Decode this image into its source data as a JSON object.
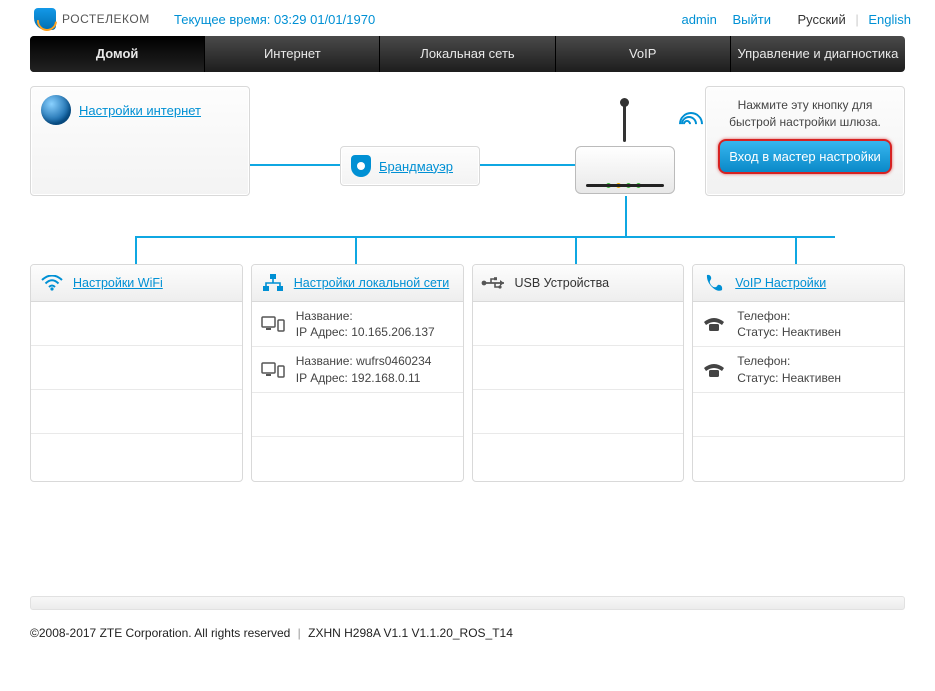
{
  "brand": "РОСТЕЛЕКОМ",
  "time_label": "Текущее время: 03:29 01/01/1970",
  "header_links": {
    "user": "admin",
    "logout": "Выйти",
    "lang_ru": "Русский",
    "lang_en": "English"
  },
  "nav": {
    "items": [
      "Домой",
      "Интернет",
      "Локальная сеть",
      "VoIP",
      "Управление и диагностика"
    ],
    "active_index": 0
  },
  "panels": {
    "internet": {
      "title": "Настройки интернет"
    },
    "firewall": {
      "title": "Брандмауэр"
    },
    "wizard": {
      "hint": "Нажмите эту кнопку для быстрой настройки шлюза.",
      "button": "Вход в мастер настройки"
    }
  },
  "columns": {
    "wifi": {
      "title": "Настройки WiFi",
      "link": true,
      "rows": [
        null,
        null,
        null,
        null
      ]
    },
    "lan": {
      "title": "Настройки локальной сети",
      "link": true,
      "rows": [
        {
          "name_label": "Название:",
          "name": "",
          "ip_label": "IP Адрес:",
          "ip": "10.165.206.137"
        },
        {
          "name_label": "Название:",
          "name": "wufrs0460234",
          "ip_label": "IP Адрес:",
          "ip": "192.168.0.11"
        },
        null,
        null
      ]
    },
    "usb": {
      "title": "USB Устройства",
      "link": false,
      "rows": [
        null,
        null,
        null,
        null
      ]
    },
    "voip": {
      "title": "VoIP Настройки",
      "link": true,
      "rows": [
        {
          "label1": "Телефон:",
          "label2": "Статус:",
          "status": "Неактивен"
        },
        {
          "label1": "Телефон:",
          "label2": "Статус:",
          "status": "Неактивен"
        },
        null,
        null
      ]
    }
  },
  "footer": {
    "copyright": "©2008-2017 ZTE Corporation. All rights reserved",
    "model": "ZXHN H298A V1.1 V1.1.20_ROS_T14"
  }
}
